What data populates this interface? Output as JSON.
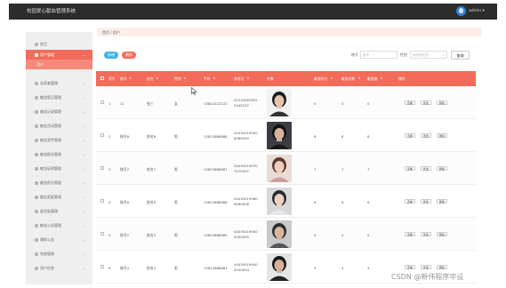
{
  "app": {
    "title": "校园爱心献血管理系统",
    "user": "admin"
  },
  "sidebar": {
    "items": [
      {
        "label": "首页",
        "icon": "home-icon",
        "active": false
      },
      {
        "label": "用户管理",
        "icon": "user-icon",
        "active": true
      },
      {
        "label": "志愿者管理",
        "icon": "list-icon",
        "active": false
      },
      {
        "label": "献血登记管理",
        "icon": "list-icon",
        "active": false
      },
      {
        "label": "献血记录管理",
        "icon": "list-icon",
        "active": false
      },
      {
        "label": "献血活动管理",
        "icon": "list-icon",
        "active": false
      },
      {
        "label": "献血宣传管理",
        "icon": "list-icon",
        "active": false
      },
      {
        "label": "献血报名管理",
        "icon": "list-icon",
        "active": false
      },
      {
        "label": "献血证明管理",
        "icon": "list-icon",
        "active": false
      },
      {
        "label": "献血积分管理",
        "icon": "list-icon",
        "active": false
      },
      {
        "label": "献血奖励管理",
        "icon": "list-icon",
        "active": false
      },
      {
        "label": "留言板管理",
        "icon": "list-icon",
        "active": false
      },
      {
        "label": "献血公告管理",
        "icon": "list-icon",
        "active": false
      },
      {
        "label": "通知公告",
        "icon": "list-icon",
        "active": false
      },
      {
        "label": "系统管理",
        "icon": "gear-icon",
        "active": false
      },
      {
        "label": "用户信息",
        "icon": "user-icon",
        "active": false
      }
    ],
    "sub_item": "用户"
  },
  "breadcrumb": "首页 / 用户",
  "toolbar": {
    "add_label": "新增",
    "delete_label": "删除",
    "account_label": "账号",
    "account_placeholder": "账号",
    "type_label": "性别",
    "type_placeholder": "请选择性别",
    "search_label": "查询"
  },
  "table": {
    "headers": [
      "索引",
      "账号",
      "姓名",
      "性别",
      "手机",
      "身份证",
      "头像",
      "献血积分",
      "献血次数",
      "献血量",
      "操作"
    ],
    "rows": [
      {
        "index": "1",
        "account": "11",
        "name": "张三",
        "sex": "女",
        "phone": "13822222222",
        "idcard": [
          "41234567891",
          "2345222"
        ],
        "score": "0",
        "times": "0",
        "amount": "0"
      },
      {
        "index": "2",
        "account": "账号8",
        "name": "姓名8",
        "sex": "男",
        "phone": "13823888888",
        "idcard": [
          "44030019900",
          "8080000"
        ],
        "score": "8",
        "times": "8",
        "amount": "8"
      },
      {
        "index": "3",
        "account": "账号7",
        "name": "姓名7",
        "sex": "男",
        "phone": "13823888887",
        "idcard": [
          "44030019970",
          "7070007"
        ],
        "score": "7",
        "times": "7",
        "amount": "7"
      },
      {
        "index": "4",
        "account": "账号6",
        "name": "姓名6",
        "sex": "男",
        "phone": "13823888886",
        "idcard": [
          "44030019960",
          "6060006"
        ],
        "score": "6",
        "times": "6",
        "amount": "6"
      },
      {
        "index": "5",
        "account": "账号5",
        "name": "姓名5",
        "sex": "男",
        "phone": "13823888885",
        "idcard": [
          "44030019950",
          "5050005"
        ],
        "score": "5",
        "times": "5",
        "amount": "5"
      },
      {
        "index": "6",
        "account": "账号4",
        "name": "姓名4",
        "sex": "男",
        "phone": "13823888884",
        "idcard": [
          "44030019940",
          "4040004"
        ],
        "score": "4",
        "times": "4",
        "amount": "4"
      }
    ],
    "actions": {
      "view": "查看",
      "edit": "修改",
      "delete": "删除"
    }
  },
  "watermark": "CSDN @新伟程序毕设",
  "colors": {
    "accent": "#f26b5b",
    "primary": "#3eb1ee",
    "topbar": "#2c2c2c"
  }
}
